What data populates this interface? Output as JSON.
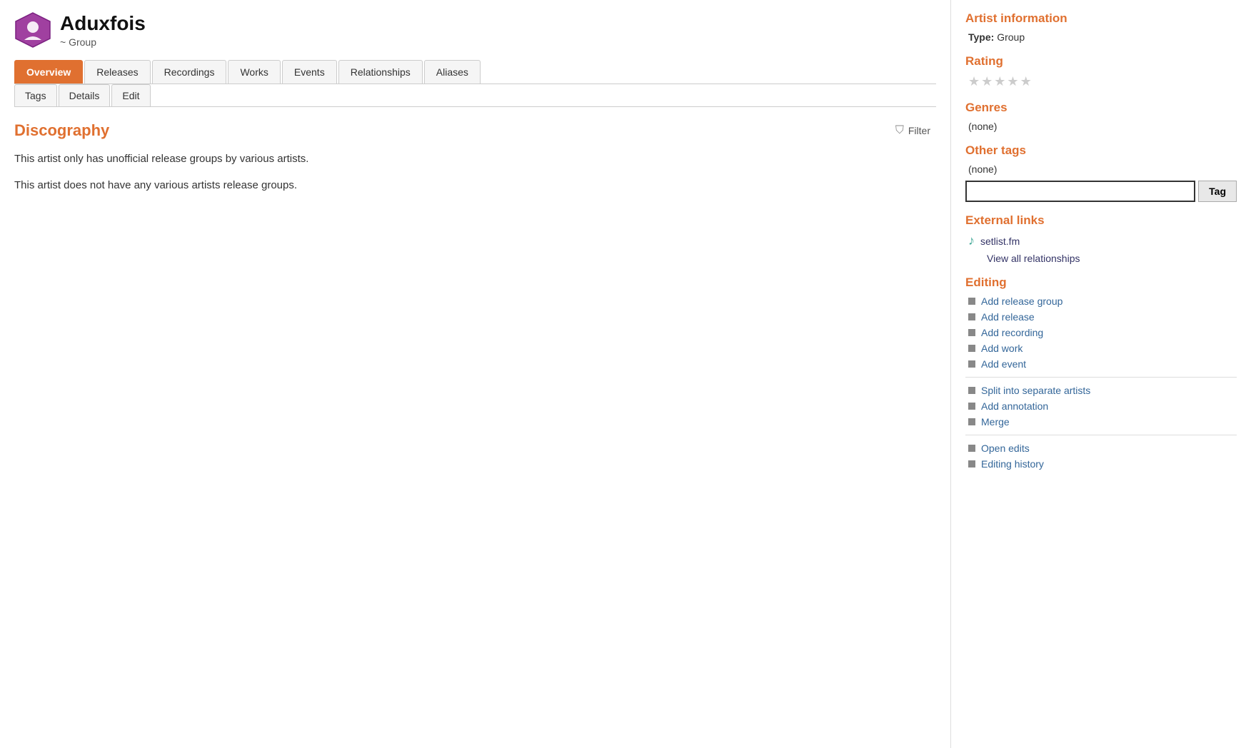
{
  "artist": {
    "name": "Aduxfois",
    "subtitle": "~ Group"
  },
  "tabs_main": [
    {
      "label": "Overview",
      "active": true
    },
    {
      "label": "Releases",
      "active": false
    },
    {
      "label": "Recordings",
      "active": false
    },
    {
      "label": "Works",
      "active": false
    },
    {
      "label": "Events",
      "active": false
    },
    {
      "label": "Relationships",
      "active": false
    },
    {
      "label": "Aliases",
      "active": false
    }
  ],
  "tabs_secondary": [
    {
      "label": "Tags"
    },
    {
      "label": "Details"
    },
    {
      "label": "Edit"
    }
  ],
  "discography": {
    "title": "Discography",
    "filter_label": "Filter",
    "message1": "This artist only has unofficial release groups by various artists.",
    "message2": "This artist does not have any various artists release groups."
  },
  "sidebar": {
    "artist_info_title": "Artist information",
    "type_label": "Type:",
    "type_value": "Group",
    "rating_title": "Rating",
    "stars": [
      "★",
      "★",
      "★",
      "★",
      "★"
    ],
    "genres_title": "Genres",
    "genres_value": "(none)",
    "other_tags_title": "Other tags",
    "other_tags_value": "(none)",
    "tag_input_placeholder": "",
    "tag_btn_label": "Tag",
    "external_links_title": "External links",
    "external_links": [
      {
        "icon": "♪",
        "label": "setlist.fm",
        "url": "#"
      },
      {
        "label": "View all relationships",
        "url": "#"
      }
    ],
    "editing_title": "Editing",
    "editing_links_group1": [
      {
        "label": "Add release group"
      },
      {
        "label": "Add release"
      },
      {
        "label": "Add recording"
      },
      {
        "label": "Add work"
      },
      {
        "label": "Add event"
      }
    ],
    "editing_links_group2": [
      {
        "label": "Split into separate artists"
      },
      {
        "label": "Add annotation"
      },
      {
        "label": "Merge"
      }
    ],
    "editing_links_group3": [
      {
        "label": "Open edits"
      },
      {
        "label": "Editing history"
      }
    ]
  }
}
